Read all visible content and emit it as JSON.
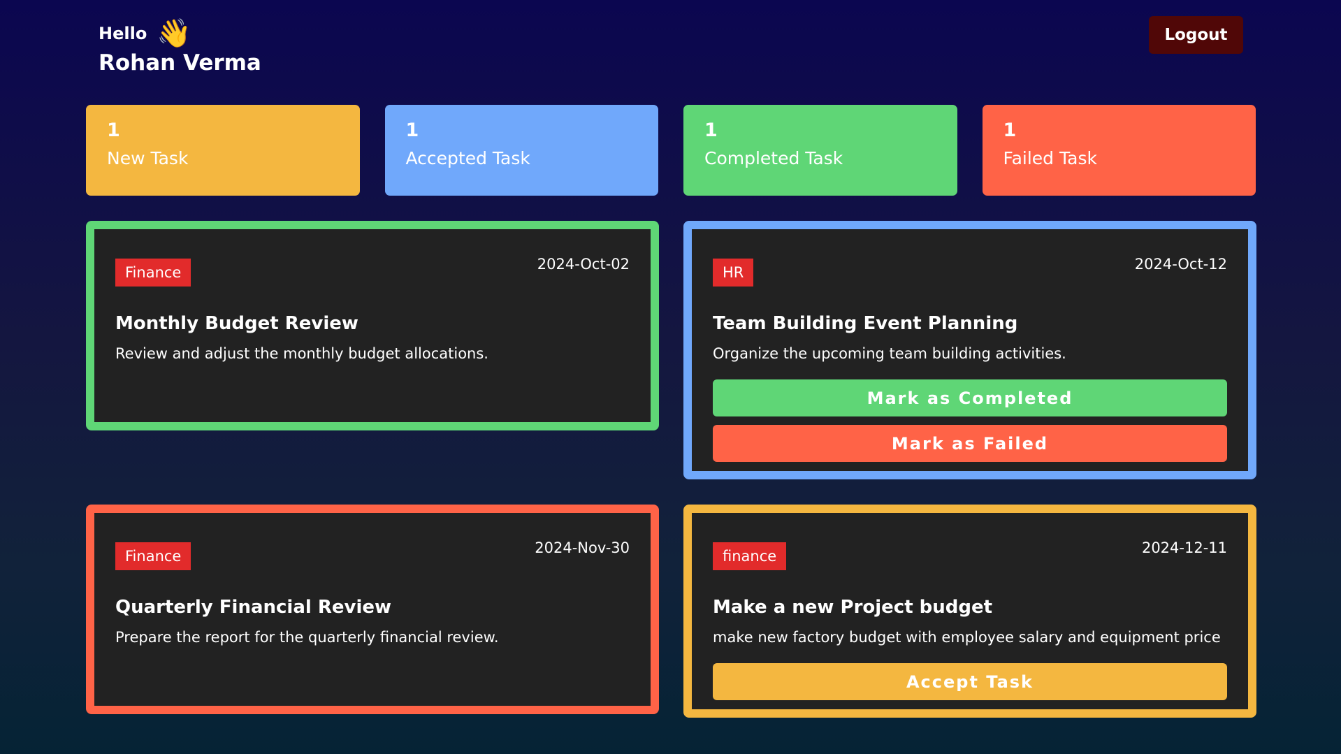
{
  "header": {
    "greeting": "Hello",
    "wave_emoji": "👋",
    "user_name": "Rohan Verma",
    "logout_label": "Logout"
  },
  "stats": [
    {
      "count": "1",
      "label": "New Task",
      "color": "#f4b740"
    },
    {
      "count": "1",
      "label": "Accepted Task",
      "color": "#70a8fb"
    },
    {
      "count": "1",
      "label": "Completed Task",
      "color": "#5fd676"
    },
    {
      "count": "1",
      "label": "Failed Task",
      "color": "#ff6347"
    }
  ],
  "tasks": [
    {
      "status": "completed",
      "border_color": "#5fd676",
      "category": "Finance",
      "date": "2024-Oct-02",
      "title": "Monthly Budget Review",
      "description": "Review and adjust the monthly budget allocations."
    },
    {
      "status": "accepted",
      "border_color": "#70a8fb",
      "category": "HR",
      "date": "2024-Oct-12",
      "title": "Team Building Event Planning",
      "description": "Organize the upcoming team building activities.",
      "mark_completed_label": "Mark as Completed",
      "mark_failed_label": "Mark as Failed"
    },
    {
      "status": "failed",
      "border_color": "#ff6347",
      "category": "Finance",
      "date": "2024-Nov-30",
      "title": "Quarterly Financial Review",
      "description": "Prepare the report for the quarterly financial review."
    },
    {
      "status": "new",
      "border_color": "#f4b740",
      "category": "finance",
      "date": "2024-12-11",
      "title": "Make a new Project budget",
      "description": "make new factory budget with employee salary and equipment price",
      "accept_label": "Accept Task"
    }
  ],
  "colors": {
    "badge": "#e22b2b",
    "card_bg": "#222222",
    "logout_bg": "#500707",
    "completed_btn": "#5fd676",
    "failed_btn": "#ff6347",
    "accept_btn": "#f4b740"
  }
}
